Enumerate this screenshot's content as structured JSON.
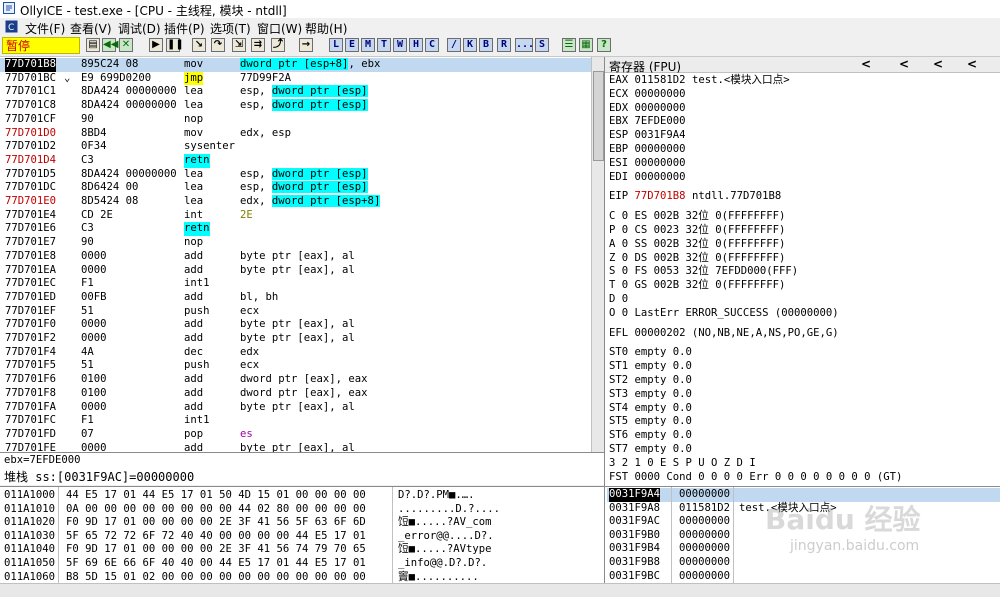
{
  "window": {
    "title": "OllyICE - test.exe - [CPU - 主线程, 模块 - ntdll]"
  },
  "menu": [
    "文件(F)",
    "查看(V)",
    "调试(D)",
    "插件(P)",
    "选项(T)",
    "窗口(W)",
    "帮助(H)"
  ],
  "status": "暂停",
  "toolbar": {
    "letters": [
      "L",
      "E",
      "M",
      "T",
      "W",
      "H",
      "C",
      "/",
      "K",
      "B",
      "R",
      "...",
      "S"
    ]
  },
  "disasm": [
    {
      "addr": "77D701B8",
      "hex": "895C24 08",
      "mn": "mov",
      "op": "dword ptr [esp+8], ebx",
      "sel": true,
      "addrRed": false
    },
    {
      "addr": "77D701BC",
      "hex": "E9 699D0200",
      "mn": "jmp",
      "op": "77D99F2A",
      "jmp": true,
      "arrow": "⌄"
    },
    {
      "addr": "77D701C1",
      "hex": "8DA424 00000000",
      "mn": "lea",
      "op": "esp, dword ptr [esp]"
    },
    {
      "addr": "77D701C8",
      "hex": "8DA424 00000000",
      "mn": "lea",
      "op": "esp, dword ptr [esp]"
    },
    {
      "addr": "77D701CF",
      "hex": "90",
      "mn": "nop",
      "op": ""
    },
    {
      "addr": "77D701D0",
      "hex": "8BD4",
      "mn": "mov",
      "op": "edx, esp",
      "addrRed": true
    },
    {
      "addr": "77D701D2",
      "hex": "0F34",
      "mn": "sysenter",
      "op": ""
    },
    {
      "addr": "77D701D4",
      "hex": "C3",
      "mn": "retn",
      "op": "",
      "addrRed": true,
      "retn": true
    },
    {
      "addr": "77D701D5",
      "hex": "8DA424 00000000",
      "mn": "lea",
      "op": "esp, dword ptr [esp]"
    },
    {
      "addr": "77D701DC",
      "hex": "8D6424 00",
      "mn": "lea",
      "op": "esp, dword ptr [esp]"
    },
    {
      "addr": "77D701E0",
      "hex": "8D5424 08",
      "mn": "lea",
      "op": "edx, dword ptr [esp+8]",
      "addrRed": true
    },
    {
      "addr": "77D701E4",
      "hex": "CD 2E",
      "mn": "int",
      "op": "2E",
      "opOlive": true
    },
    {
      "addr": "77D701E6",
      "hex": "C3",
      "mn": "retn",
      "op": "",
      "retn": true
    },
    {
      "addr": "77D701E7",
      "hex": "90",
      "mn": "nop",
      "op": ""
    },
    {
      "addr": "77D701E8",
      "hex": "0000",
      "mn": "add",
      "op": "byte ptr [eax], al"
    },
    {
      "addr": "77D701EA",
      "hex": "0000",
      "mn": "add",
      "op": "byte ptr [eax], al"
    },
    {
      "addr": "77D701EC",
      "hex": "F1",
      "mn": "int1",
      "op": ""
    },
    {
      "addr": "77D701ED",
      "hex": "00FB",
      "mn": "add",
      "op": "bl, bh"
    },
    {
      "addr": "77D701EF",
      "hex": "51",
      "mn": "push",
      "op": "ecx"
    },
    {
      "addr": "77D701F0",
      "hex": "0000",
      "mn": "add",
      "op": "byte ptr [eax], al"
    },
    {
      "addr": "77D701F2",
      "hex": "0000",
      "mn": "add",
      "op": "byte ptr [eax], al"
    },
    {
      "addr": "77D701F4",
      "hex": "4A",
      "mn": "dec",
      "op": "edx"
    },
    {
      "addr": "77D701F5",
      "hex": "51",
      "mn": "push",
      "op": "ecx"
    },
    {
      "addr": "77D701F6",
      "hex": "0100",
      "mn": "add",
      "op": "dword ptr [eax], eax"
    },
    {
      "addr": "77D701F8",
      "hex": "0100",
      "mn": "add",
      "op": "dword ptr [eax], eax"
    },
    {
      "addr": "77D701FA",
      "hex": "0000",
      "mn": "add",
      "op": "byte ptr [eax], al"
    },
    {
      "addr": "77D701FC",
      "hex": "F1",
      "mn": "int1",
      "op": ""
    },
    {
      "addr": "77D701FD",
      "hex": "07",
      "mn": "pop",
      "op": "es",
      "opPurple": true
    },
    {
      "addr": "77D701FE",
      "hex": "0000",
      "mn": "add",
      "op": "byte ptr [eax], al"
    }
  ],
  "info": {
    "line1": "ebx=7EFDE000",
    "line2": "堆栈 ss:[0031F9AC]=00000000"
  },
  "registers": {
    "header": "寄存器 (FPU)",
    "gp": [
      {
        "name": "EAX",
        "val": "011581D2",
        "extra": "test.<模块入口点>"
      },
      {
        "name": "ECX",
        "val": "00000000",
        "extra": ""
      },
      {
        "name": "EDX",
        "val": "00000000",
        "extra": ""
      },
      {
        "name": "EBX",
        "val": "7EFDE000",
        "extra": ""
      },
      {
        "name": "ESP",
        "val": "0031F9A4",
        "extra": ""
      },
      {
        "name": "EBP",
        "val": "00000000",
        "extra": ""
      },
      {
        "name": "ESI",
        "val": "00000000",
        "extra": ""
      },
      {
        "name": "EDI",
        "val": "00000000",
        "extra": ""
      }
    ],
    "eip": {
      "name": "EIP",
      "val": "77D701B8",
      "extra": "ntdll.77D701B8"
    },
    "flags": [
      "C 0  ES 002B 32位 0(FFFFFFFF)",
      "P 0  CS 0023 32位 0(FFFFFFFF)",
      "A 0  SS 002B 32位 0(FFFFFFFF)",
      "Z 0  DS 002B 32位 0(FFFFFFFF)",
      "S 0  FS 0053 32位 7EFDD000(FFF)",
      "T 0  GS 002B 32位 0(FFFFFFFF)",
      "D 0",
      "O 0  LastErr ERROR_SUCCESS (00000000)"
    ],
    "efl": "EFL 00000202 (NO,NB,NE,A,NS,PO,GE,G)",
    "fpu": [
      "ST0 empty 0.0",
      "ST1 empty 0.0",
      "ST2 empty 0.0",
      "ST3 empty 0.0",
      "ST4 empty 0.0",
      "ST5 empty 0.0",
      "ST6 empty 0.0",
      "ST7 empty 0.0"
    ],
    "fpuhdr": "               3 2 1 0      E S P U O Z D I",
    "fst": "FST 0000  Cond 0 0 0 0  Err 0 0 0 0 0 0 0 0  (GT)"
  },
  "dump": [
    {
      "addr": "011A1000",
      "hex": "44 E5 17 01 44 E5 17 01 50 4D 15 01 00 00 00 00",
      "ascii": "D?.D?.PM■.…."
    },
    {
      "addr": "011A1010",
      "hex": "0A 00 00 00 00 00 00 00 00 44 02 80 00 00 00 00",
      "ascii": ".........D.?...."
    },
    {
      "addr": "011A1020",
      "hex": "F0 9D 17 01 00 00 00 00 2E 3F 41 56 5F 63 6F 6D",
      "ascii": "饾■.....?AV_com"
    },
    {
      "addr": "011A1030",
      "hex": "5F 65 72 72 6F 72 40 40 00 00 00 00 44 E5 17 01",
      "ascii": "_error@@....D?."
    },
    {
      "addr": "011A1040",
      "hex": "F0 9D 17 01 00 00 00 00 2E 3F 41 56 74 79 70 65",
      "ascii": "饾■.....?AVtype"
    },
    {
      "addr": "011A1050",
      "hex": "5F 69 6E 66 6F 40 40 00 44 E5 17 01 44 E5 17 01",
      "ascii": "_info@@.D?.D?."
    },
    {
      "addr": "011A1060",
      "hex": "B8 5D 15 01 02 00 00 00 00 00 00 00 00 00 00 00",
      "ascii": "竇■.........."
    }
  ],
  "stack": [
    {
      "addr": "0031F9A4",
      "val": "00000000",
      "extra": "",
      "sel": true
    },
    {
      "addr": "0031F9A8",
      "val": "011581D2",
      "extra": "test.<模块入口点>"
    },
    {
      "addr": "0031F9AC",
      "val": "00000000",
      "extra": ""
    },
    {
      "addr": "0031F9B0",
      "val": "00000000",
      "extra": ""
    },
    {
      "addr": "0031F9B4",
      "val": "00000000",
      "extra": ""
    },
    {
      "addr": "0031F9B8",
      "val": "00000000",
      "extra": ""
    },
    {
      "addr": "0031F9BC",
      "val": "00000000",
      "extra": ""
    }
  ],
  "watermark": {
    "brand": "Baidu 经验",
    "url": "jingyan.baidu.com"
  }
}
